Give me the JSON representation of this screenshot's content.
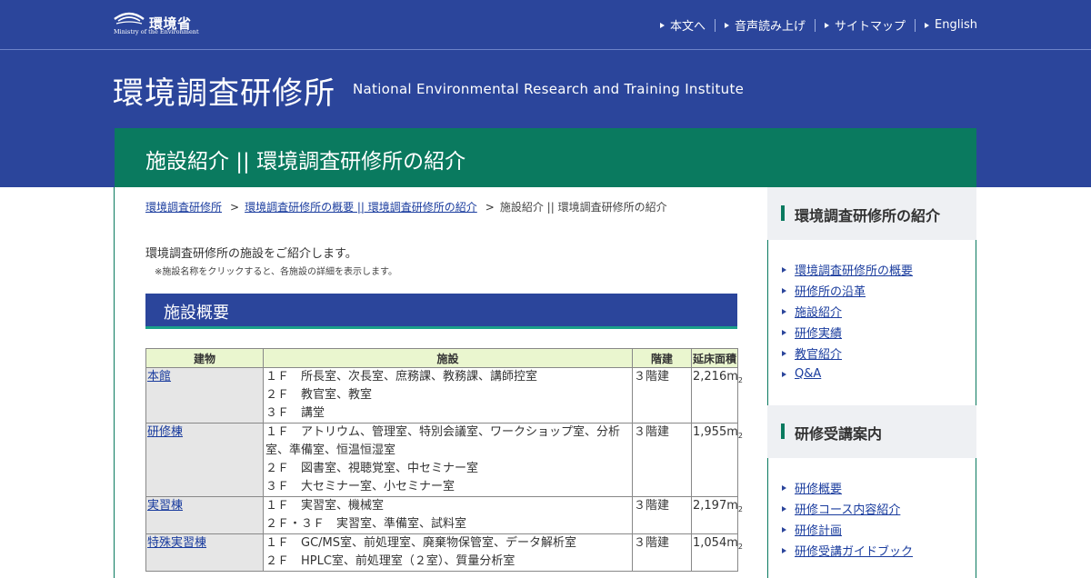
{
  "header": {
    "logo_jp": "環境省",
    "logo_en": "Ministry of the Environment",
    "utility_links": [
      "本文へ",
      "音声読み上げ",
      "サイトマップ",
      "English"
    ]
  },
  "site": {
    "title_jp": "環境調査研修所",
    "title_en": "National Environmental Research and Training Institute"
  },
  "page": {
    "heading": "施設紹介 || 環境調査研修所の紹介",
    "breadcrumb": [
      "環境調査研修所",
      "環境調査研修所の概要 || 環境調査研修所の紹介",
      "施設紹介 || 環境調査研修所の紹介"
    ],
    "breadcrumb_sep": ">",
    "intro": "環境調査研修所の施設をご紹介します。",
    "note": "※施設名称をクリックすると、各施設の詳細を表示します。",
    "section_title": "施設概要"
  },
  "table": {
    "headers": [
      "建物",
      "施設",
      "階建",
      "延床面積"
    ],
    "area_unit_sub": "2",
    "rows": [
      {
        "name": "本館",
        "floors": [
          "１Ｆ　所長室、次長室、庶務課、教務課、講師控室",
          "２Ｆ　教官室、教室",
          "３Ｆ　講堂"
        ],
        "stories": "３階建",
        "area": "2,216m"
      },
      {
        "name": "研修棟",
        "floors": [
          "１Ｆ　アトリウム、管理室、特別会議室、ワークショップ室、分析室、準備室、恒温恒湿室",
          "２Ｆ　図書室、視聴覚室、中セミナー室",
          "３Ｆ　大セミナー室、小セミナー室"
        ],
        "stories": "３階建",
        "area": "1,955m"
      },
      {
        "name": "実習棟",
        "floors": [
          "１Ｆ　実習室、機械室",
          "２Ｆ・３Ｆ　実習室、準備室、試料室"
        ],
        "stories": "３階建",
        "area": "2,197m"
      },
      {
        "name": "特殊実習棟",
        "floors": [
          "１Ｆ　GC/MS室、前処理室、廃棄物保管室、データ解析室",
          "２Ｆ　HPLC室、前処理室（２室）、質量分析室"
        ],
        "stories": "３階建",
        "area": "1,054m"
      }
    ]
  },
  "sidebar": {
    "sections": [
      {
        "title": "環境調査研修所の紹介",
        "links": [
          "環境調査研修所の概要",
          "研修所の沿革",
          "施設紹介",
          "研修実績",
          "教官紹介",
          "Q&A"
        ]
      },
      {
        "title": "研修受講案内",
        "links": [
          "研修概要",
          "研修コース内容紹介",
          "研修計画",
          "研修受講ガイドブック"
        ]
      }
    ]
  }
}
